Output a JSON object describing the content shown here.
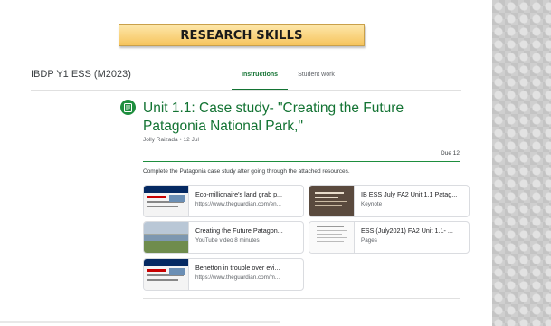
{
  "banner": {
    "text": "RESEARCH SKILLS"
  },
  "course": {
    "title": "IBDP Y1 ESS (M2023)"
  },
  "tabs": [
    {
      "label": "Instructions",
      "active": true
    },
    {
      "label": "Student work",
      "active": false
    }
  ],
  "assignment": {
    "icon": "assignment-icon",
    "title": "Unit 1.1: Case study- \"Creating the Future Patagonia National Park,\"",
    "meta": "Jolly Raizada • 12 Jul",
    "due": "Due 12",
    "instructions": "Complete the Patagonia case study after going through the attached resources."
  },
  "attachments": [
    {
      "title": "Eco-millionaire's land grab p...",
      "subtitle": "https://www.theguardian.com/en...",
      "thumb": "guardian-thumb"
    },
    {
      "title": "IB ESS July FA2 Unit 1.1 Patag...",
      "subtitle": "Keynote",
      "thumb": "keynote-thumb"
    },
    {
      "title": "Creating the Future Patagon...",
      "subtitle": "YouTube video  8 minutes",
      "thumb": "landscape-thumb"
    },
    {
      "title": "ESS (July2021) FA2 Unit 1.1- ...",
      "subtitle": "Pages",
      "thumb": "pages-thumb"
    },
    {
      "title": "Benetton in trouble over evi...",
      "subtitle": "https://www.theguardian.com/m...",
      "thumb": "guardian-thumb"
    }
  ],
  "colors": {
    "accent": "#137333",
    "banner": "#f6c45d"
  }
}
